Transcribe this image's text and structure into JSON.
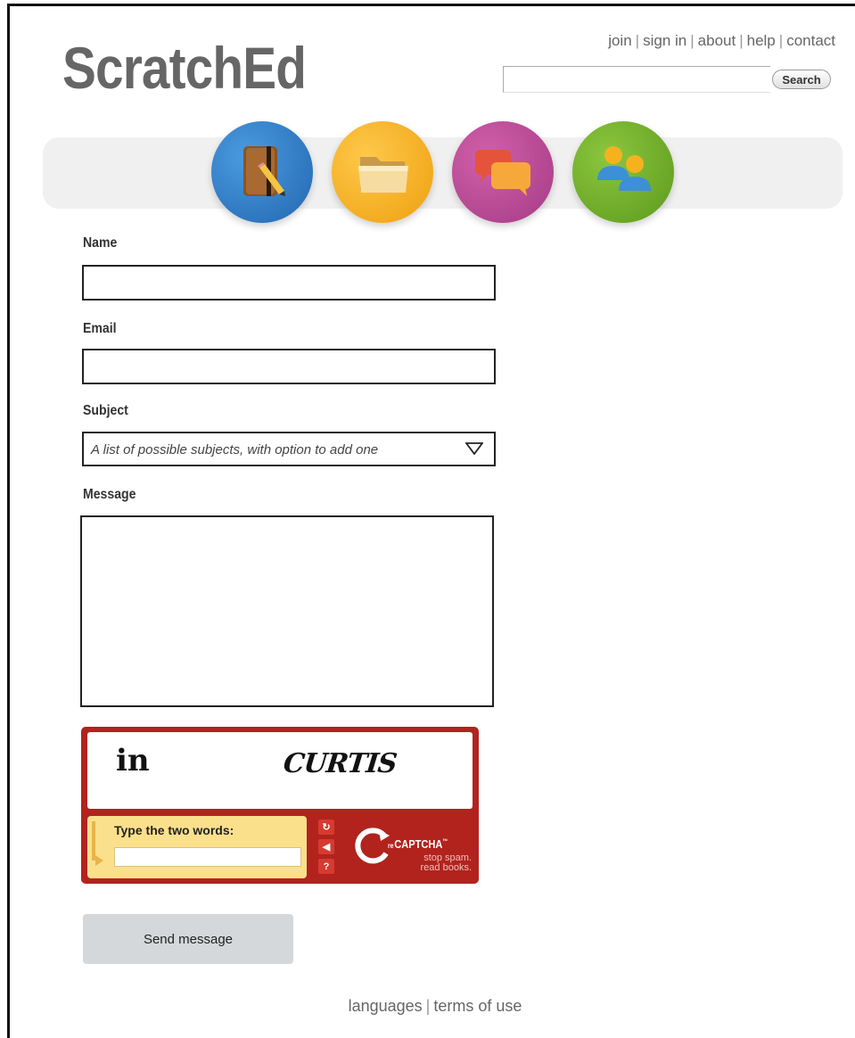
{
  "header": {
    "logo": "ScratchEd",
    "links": [
      "join",
      "sign in",
      "about",
      "help",
      "contact"
    ],
    "search": {
      "value": "",
      "button_label": "Search"
    }
  },
  "nav": {
    "icons": [
      "notebook-icon",
      "folder-icon",
      "chat-bubbles-icon",
      "people-icon"
    ],
    "colors": {
      "blue": "#2f7fd0",
      "yellow": "#f5b21e",
      "magenta": "#b8479a",
      "green": "#74b02b"
    }
  },
  "form": {
    "name_label": "Name",
    "name_value": "",
    "email_label": "Email",
    "email_value": "",
    "subject_label": "Subject",
    "subject_selected": "A list of possible subjects, with option to add one",
    "message_label": "Message",
    "message_value": ""
  },
  "captcha": {
    "word1": "in",
    "word2": "CURTIS",
    "prompt": "Type the two words:",
    "answer_value": "",
    "brand_prefix": "re",
    "brand": "CAPTCHA",
    "tm": "™",
    "tagline_1": "stop spam.",
    "tagline_2": "read books.",
    "controls": [
      "refresh-icon",
      "audio-icon",
      "help-icon"
    ],
    "colors": {
      "frame": "#b2231e",
      "panel": "#fbe08c"
    }
  },
  "actions": {
    "send_label": "Send message"
  },
  "footer": {
    "links": [
      "languages",
      "terms of use"
    ]
  }
}
